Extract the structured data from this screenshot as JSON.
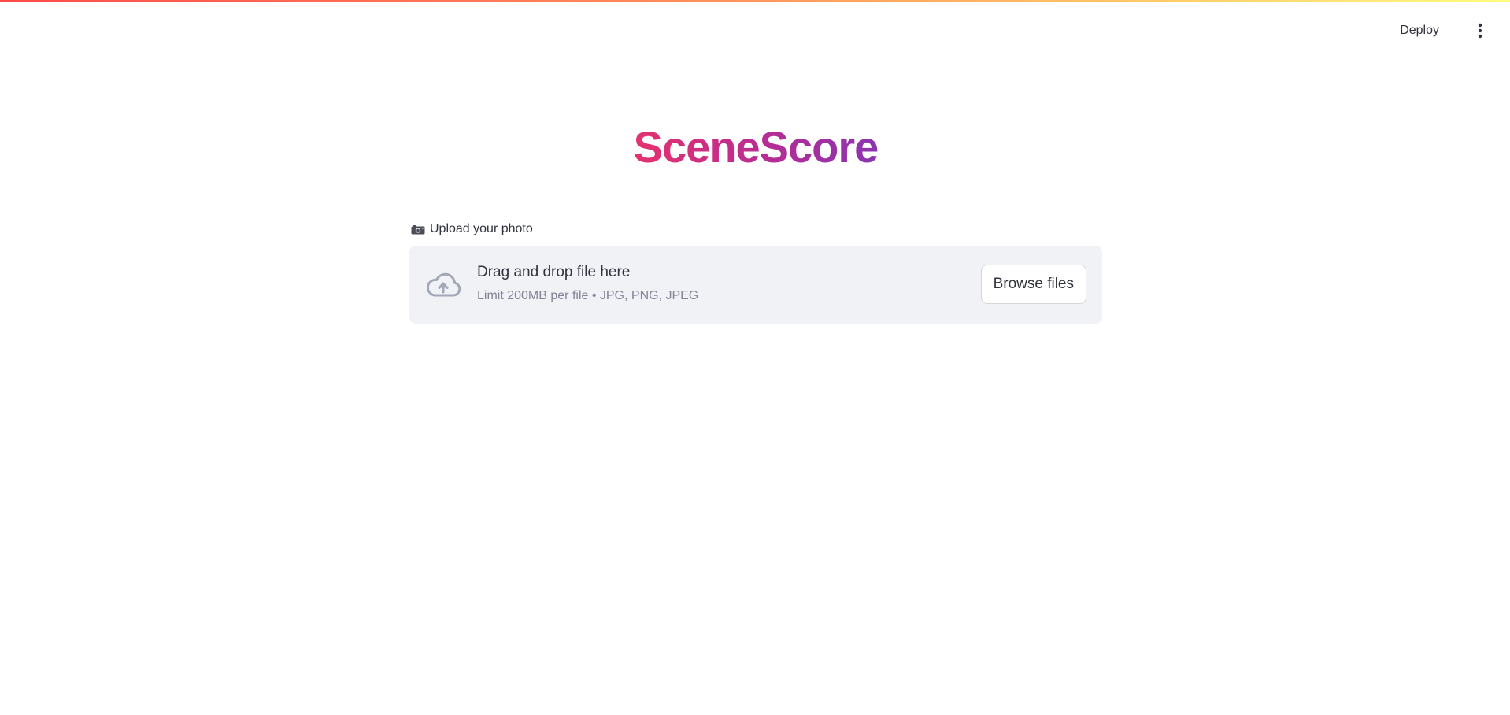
{
  "header": {
    "deploy_label": "Deploy",
    "menu_icon": "more-vertical-icon"
  },
  "main": {
    "title": "SceneScore",
    "uploader": {
      "label": "Upload your photo",
      "label_icon": "camera-icon",
      "dropzone_title": "Drag and drop file here",
      "dropzone_subtitle": "Limit 200MB per file • JPG, PNG, JPEG",
      "browse_label": "Browse files",
      "cloud_icon": "cloud-upload-icon"
    }
  },
  "colors": {
    "title_gradient_start": "#e6316f",
    "title_gradient_end": "#8a34b0",
    "dropzone_bg": "#f0f2f6",
    "text": "#31333f",
    "muted_text": "#808495"
  }
}
